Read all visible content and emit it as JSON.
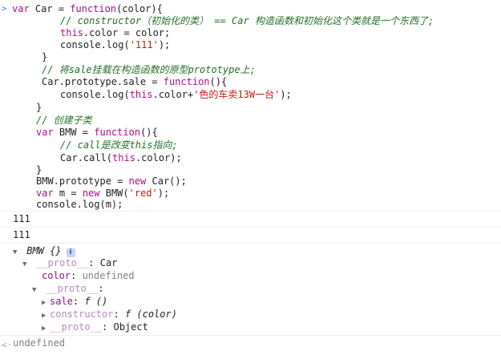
{
  "code": {
    "line1": {
      "kw1": "var",
      "t1": " Car = ",
      "kw2": "function",
      "t2": "(color){"
    },
    "line2": {
      "comment": "// constructor（初始化的类） == Car 构造函数和初始化这个类就是一个东西了;"
    },
    "line3": {
      "kw": "this",
      "t": ".color = color;"
    },
    "line4": {
      "t1": "console.log(",
      "str": "'111'",
      "t2": ");"
    },
    "line5": {
      "t": "}"
    },
    "line6": {
      "comment": "// 将sale挂载在构造函数的原型prototype上;"
    },
    "line7": {
      "t1": "Car.prototype.sale = ",
      "kw": "function",
      "t2": "(){"
    },
    "line8": {
      "t1": "console.log(",
      "kw": "this",
      "t2": ".color+",
      "str": "'色的车卖13W一台'",
      "t3": ");"
    },
    "line9": {
      "t": "}"
    },
    "line10": {
      "comment": "// 创建子类"
    },
    "line11": {
      "kw1": "var",
      "t1": " BMW = ",
      "kw2": "function",
      "t2": "(){"
    },
    "line12": {
      "comment": "// call是改变this指向;"
    },
    "line13": {
      "t1": "Car.call(",
      "kw": "this",
      "t2": ".color);"
    },
    "line14": {
      "t": "}"
    },
    "line15": {
      "t1": "BMW.prototype = ",
      "kw": "new",
      "t2": " Car();"
    },
    "line16": {
      "kw1": "var",
      "t1": " m = ",
      "kw2": "new",
      "t2": " BMW(",
      "str": "'red'",
      "t3": ");"
    },
    "line17": {
      "t": "console.log(m);"
    }
  },
  "output": {
    "log1": "111",
    "log2": "111",
    "obj_header": "BMW {}",
    "info_badge": "i",
    "proto1_key": "__proto__",
    "proto1_val": "Car",
    "color_key": "color",
    "color_val": "undefined",
    "proto2_key": "__proto__",
    "sale_key": "sale",
    "sale_val": "f ()",
    "ctor_key": "constructor",
    "ctor_val": "f (color)",
    "proto3_key": "__proto__",
    "proto3_val": "Object",
    "result": "undefined"
  },
  "icons": {
    "prompt": "chevron-right-icon",
    "expand_open": "triangle-down-icon",
    "expand_closed": "triangle-right-icon",
    "result": "chevron-left-icon"
  },
  "colors": {
    "keyword": "#aa0d91",
    "string": "#c41a16",
    "comment": "#236e25",
    "property": "#881391"
  }
}
